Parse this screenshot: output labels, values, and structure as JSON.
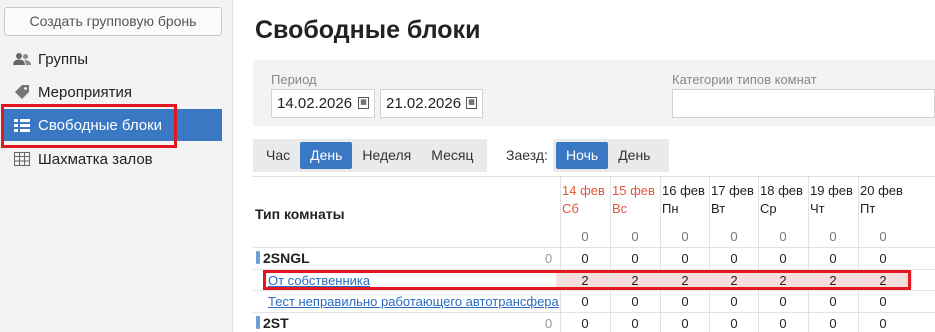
{
  "sidebar": {
    "create_button": "Создать групповую бронь",
    "items": [
      {
        "label": "Группы",
        "icon": "users-icon"
      },
      {
        "label": "Мероприятия",
        "icon": "tag-icon"
      },
      {
        "label": "Свободные блоки",
        "icon": "grid-icon",
        "active": true
      },
      {
        "label": "Шахматка залов",
        "icon": "table-icon"
      }
    ]
  },
  "page": {
    "title": "Свободные блоки"
  },
  "filters": {
    "period_label": "Период",
    "date_from": "14.02.2026",
    "date_to": "21.02.2026",
    "categories_label": "Категории типов комнат",
    "categories_value": ""
  },
  "scale": {
    "options": [
      "Час",
      "День",
      "Неделя",
      "Месяц"
    ],
    "selected": "День"
  },
  "checkin": {
    "label": "Заезд:",
    "options": [
      "Ночь",
      "День"
    ],
    "selected": "Ночь"
  },
  "table": {
    "type_header": "Тип комнаты",
    "days": [
      {
        "date": "14 фев",
        "dow": "Сб",
        "weekend": true
      },
      {
        "date": "15 фев",
        "dow": "Вс",
        "weekend": true
      },
      {
        "date": "16 фев",
        "dow": "Пн",
        "weekend": false
      },
      {
        "date": "17 фев",
        "dow": "Вт",
        "weekend": false
      },
      {
        "date": "18 фев",
        "dow": "Ср",
        "weekend": false
      },
      {
        "date": "19 фев",
        "dow": "Чт",
        "weekend": false
      },
      {
        "date": "20 фев",
        "dow": "Пт",
        "weekend": false
      }
    ],
    "totals_row": [
      "0",
      "0",
      "0",
      "0",
      "0",
      "0",
      "0"
    ],
    "rows": [
      {
        "kind": "room",
        "name": "2SNGL",
        "total": "0",
        "values": [
          "0",
          "0",
          "0",
          "0",
          "0",
          "0",
          "0"
        ]
      },
      {
        "kind": "sub",
        "name": "От собственника",
        "values": [
          "2",
          "2",
          "2",
          "2",
          "2",
          "2",
          "2"
        ]
      },
      {
        "kind": "sub",
        "name": "Тест неправильно работающего автотрансфера",
        "values": [
          "0",
          "0",
          "0",
          "0",
          "0",
          "0",
          "0"
        ]
      },
      {
        "kind": "room",
        "name": "2ST",
        "total": "0",
        "values": [
          "0",
          "0",
          "0",
          "0",
          "0",
          "0",
          "0"
        ]
      }
    ]
  },
  "colors": {
    "accent": "#3a78c3",
    "highlight": "#e2171f",
    "weekend": "#e0553b"
  }
}
